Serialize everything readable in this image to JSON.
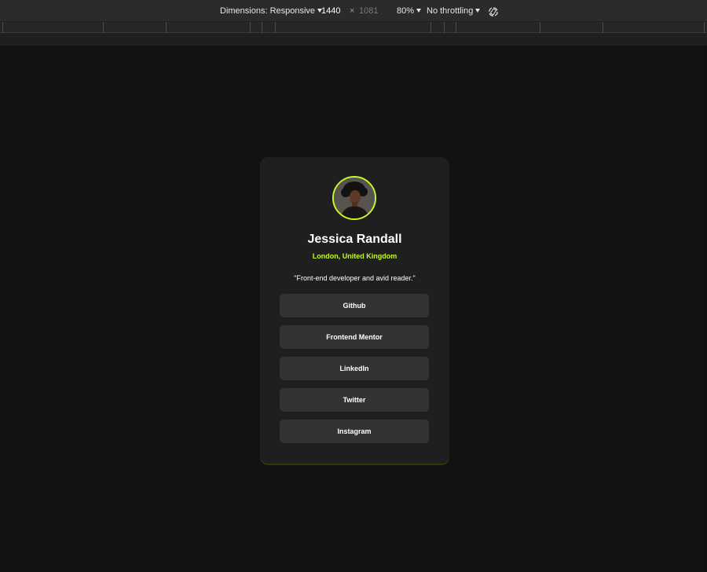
{
  "devtools": {
    "dimensions_label": "Dimensions: Responsive",
    "width": "1440",
    "separator": "×",
    "height": "1081",
    "zoom": "80%",
    "throttling": "No throttling"
  },
  "profile": {
    "name": "Jessica Randall",
    "location": "London, United Kingdom",
    "bio": "\"Front-end developer and avid reader.\"",
    "accent_color": "#c4f82a"
  },
  "links": [
    {
      "label": "Github"
    },
    {
      "label": "Frontend Mentor"
    },
    {
      "label": "LinkedIn"
    },
    {
      "label": "Twitter"
    },
    {
      "label": "Instagram"
    }
  ]
}
